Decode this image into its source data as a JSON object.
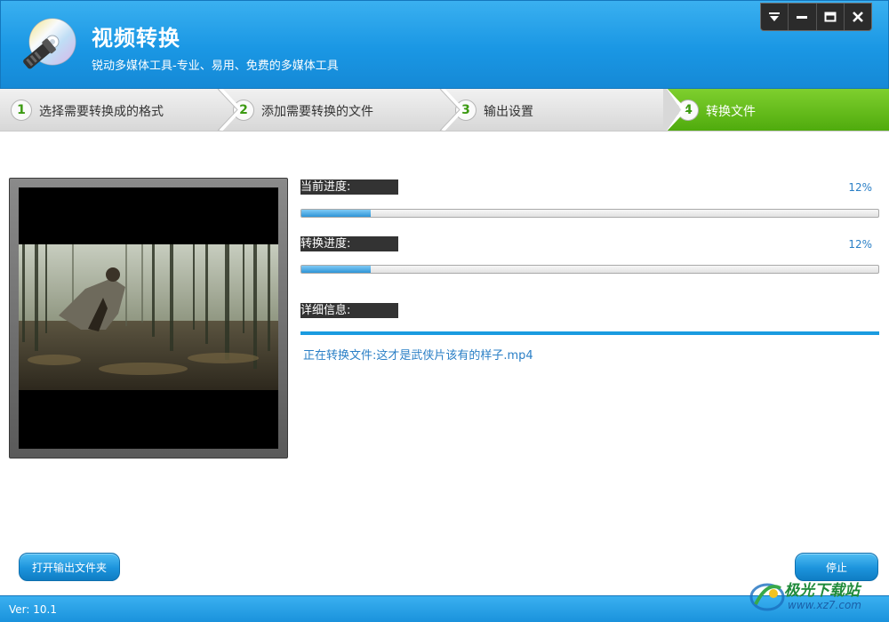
{
  "header": {
    "title": "视频转换",
    "subtitle": "锐动多媒体工具-专业、易用、免费的多媒体工具"
  },
  "window_controls": [
    "menu-icon",
    "minimize-icon",
    "maximize-icon",
    "close-icon"
  ],
  "steps": [
    {
      "number": "1",
      "label": "选择需要转换成的格式",
      "active": false
    },
    {
      "number": "2",
      "label": "添加需要转换的文件",
      "active": false
    },
    {
      "number": "3",
      "label": "输出设置",
      "active": false
    },
    {
      "number": "4",
      "label": "转换文件",
      "active": true
    }
  ],
  "progress": {
    "current_label": "当前进度:",
    "current_percent": "12%",
    "current_value": 0.12,
    "total_label": "转换进度:",
    "total_percent": "12%",
    "total_value": 0.12
  },
  "details": {
    "label": "详细信息:",
    "message": "正在转换文件:这才是武侠片该有的样子.mp4"
  },
  "buttons": {
    "open_folder": "打开输出文件夹",
    "stop": "停止"
  },
  "status": {
    "version": "Ver: 10.1"
  },
  "watermark": {
    "line1": "极光下载站",
    "line2": "www.xz7.com"
  },
  "colors": {
    "brand_blue": "#1a97e4",
    "active_step_green": "#5fb81a",
    "progress_fill": "#2e94d6"
  }
}
